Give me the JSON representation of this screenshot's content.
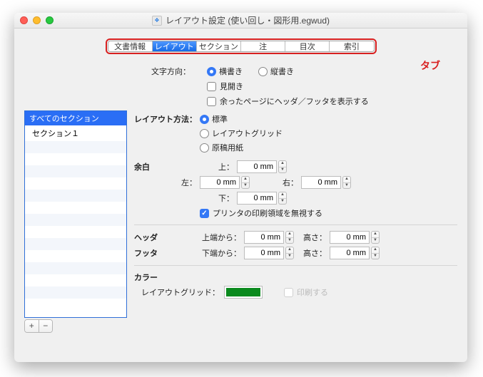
{
  "window": {
    "title": "レイアウト設定 (使い回し・図形用.egwud)"
  },
  "tabs": [
    "文書情報",
    "レイアウト",
    "セクション",
    "注",
    "目次",
    "索引"
  ],
  "tabs_active_index": 1,
  "tab_annotation": "タブ",
  "direction": {
    "label": "文字方向：",
    "options": [
      "横書き",
      "縦書き"
    ],
    "selected": 0
  },
  "spread": {
    "label": "見開き",
    "checked": false
  },
  "applyHF": {
    "label": "余ったページにヘッダ／フッタを表示する",
    "checked": false
  },
  "sectionList": {
    "header": "すべてのセクション",
    "items": [
      "セクション１"
    ]
  },
  "add": "+",
  "remove": "−",
  "layoutMethod": {
    "label": "レイアウト方法：",
    "options": [
      "標準",
      "レイアウトグリッド",
      "原稿用紙"
    ],
    "selected": 0
  },
  "margin": {
    "label": "余白",
    "top": {
      "label": "上：",
      "value": "0 mm"
    },
    "left": {
      "label": "左：",
      "value": "0 mm"
    },
    "right": {
      "label": "右：",
      "value": "0 mm"
    },
    "bottom": {
      "label": "下：",
      "value": "0 mm"
    },
    "ignorePrinter": {
      "label": "プリンタの印刷領域を無視する",
      "checked": true
    }
  },
  "header": {
    "label": "ヘッダ",
    "from": "上端から：",
    "fromVal": "0 mm",
    "height": "高さ：",
    "heightVal": "0 mm"
  },
  "footer": {
    "label": "フッタ",
    "from": "下端から：",
    "fromVal": "0 mm",
    "height": "高さ：",
    "heightVal": "0 mm"
  },
  "color": {
    "label": "カラー",
    "grid": "レイアウトグリッド：",
    "print": "印刷する"
  }
}
